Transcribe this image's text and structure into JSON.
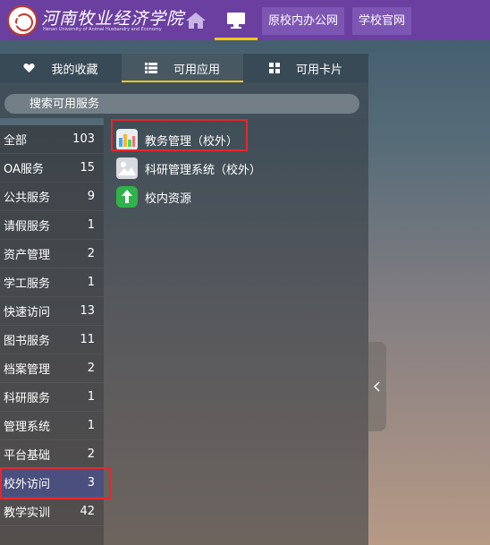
{
  "header": {
    "logo_text": "河南牧业经济学院",
    "logo_subtext": "Henan University of Animal Husbandry and Economy",
    "nav_links": [
      "原校内办公网",
      "学校官网"
    ],
    "accent_color": "#6a3fa0",
    "active_indicator_color": "#f5c518"
  },
  "tabs": [
    {
      "label": "我的收藏",
      "icon": "heart-icon"
    },
    {
      "label": "可用应用",
      "icon": "list-icon",
      "active": true
    },
    {
      "label": "可用卡片",
      "icon": "grid-icon"
    }
  ],
  "search": {
    "placeholder": "搜索可用服务"
  },
  "categories": [
    {
      "label": "全部",
      "count": "103"
    },
    {
      "label": "OA服务",
      "count": "15"
    },
    {
      "label": "公共服务",
      "count": "9"
    },
    {
      "label": "请假服务",
      "count": "1"
    },
    {
      "label": "资产管理",
      "count": "2"
    },
    {
      "label": "学工服务",
      "count": "1"
    },
    {
      "label": "快速访问",
      "count": "13"
    },
    {
      "label": "图书服务",
      "count": "11"
    },
    {
      "label": "档案管理",
      "count": "2"
    },
    {
      "label": "科研服务",
      "count": "1"
    },
    {
      "label": "管理系统",
      "count": "1"
    },
    {
      "label": "平台基础",
      "count": "2"
    },
    {
      "label": "校外访问",
      "count": "3",
      "active": true
    },
    {
      "label": "教学实训",
      "count": "42"
    }
  ],
  "apps": [
    {
      "label": "教务管理（校外）",
      "icon": "academic-affairs-icon"
    },
    {
      "label": "科研管理系统（校外）",
      "icon": "research-management-icon"
    },
    {
      "label": "校内资源",
      "icon": "campus-resources-icon"
    }
  ],
  "highlight_color": "#e8262b"
}
